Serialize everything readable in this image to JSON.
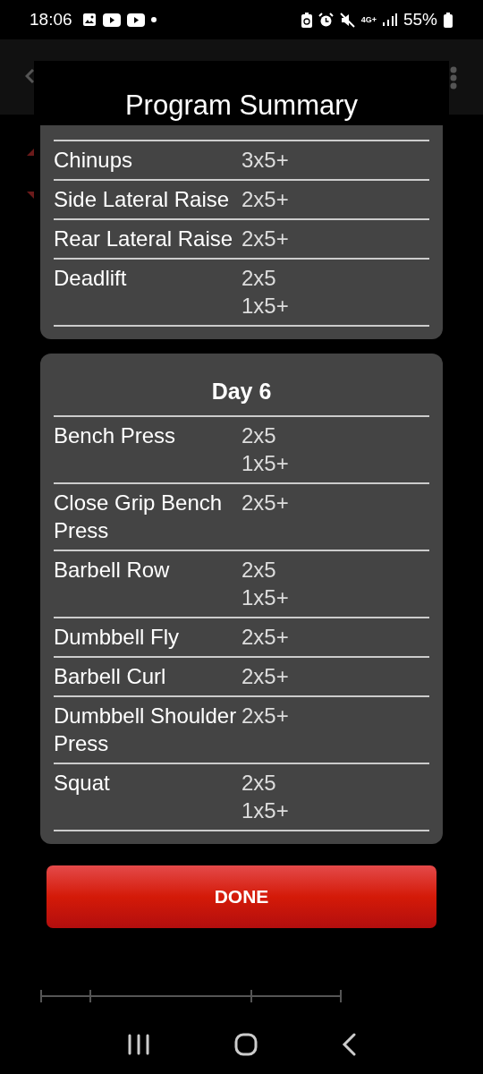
{
  "status_bar": {
    "time": "18:06",
    "network": "4G+",
    "battery": "55%"
  },
  "dialog": {
    "title": "Program Summary",
    "days": [
      {
        "exercises": [
          {
            "name": "Chinups",
            "sets": [
              "3x5+"
            ]
          },
          {
            "name": "Side Lateral Raise",
            "sets": [
              "2x5+"
            ]
          },
          {
            "name": "Rear Lateral Raise",
            "sets": [
              "2x5+"
            ]
          },
          {
            "name": "Deadlift",
            "sets": [
              "2x5",
              "1x5+"
            ]
          }
        ]
      },
      {
        "title": "Day 6",
        "exercises": [
          {
            "name": "Bench Press",
            "sets": [
              "2x5",
              "1x5+"
            ]
          },
          {
            "name": "Close Grip Bench Press",
            "sets": [
              "2x5+"
            ]
          },
          {
            "name": "Barbell Row",
            "sets": [
              "2x5",
              "1x5+"
            ]
          },
          {
            "name": "Dumbbell Fly",
            "sets": [
              "2x5+"
            ]
          },
          {
            "name": "Barbell Curl",
            "sets": [
              "2x5+"
            ]
          },
          {
            "name": "Dumbbell Shoulder Press",
            "sets": [
              "2x5+"
            ]
          },
          {
            "name": "Squat",
            "sets": [
              "2x5",
              "1x5+"
            ]
          }
        ]
      }
    ],
    "button": "DONE"
  }
}
